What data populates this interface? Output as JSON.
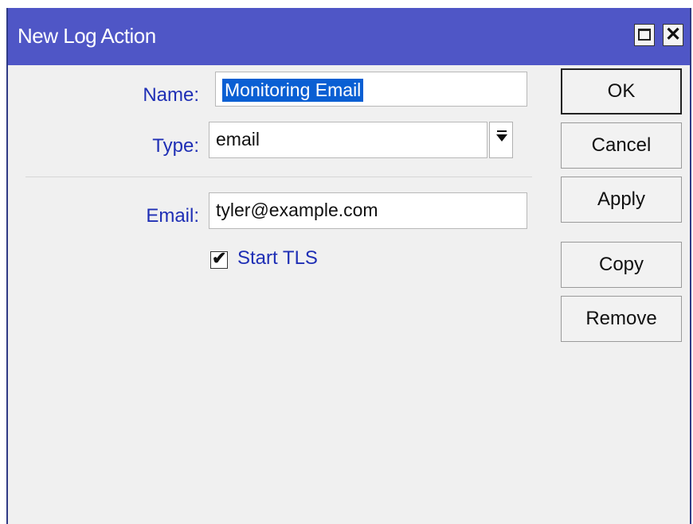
{
  "window": {
    "title": "New Log Action",
    "controls": {
      "maximize_icon": "maximize-icon",
      "close_icon": "close-icon",
      "close_glyph": "✕"
    }
  },
  "form": {
    "name": {
      "label": "Name:",
      "value": "Monitoring Email",
      "selected": true
    },
    "type": {
      "label": "Type:",
      "value": "email",
      "dropdown_icon": "chevron-down-icon"
    },
    "email": {
      "label": "Email:",
      "value": "tyler@example.com"
    },
    "start_tls": {
      "label": "Start TLS",
      "checked": true,
      "mark": "✔"
    }
  },
  "buttons": {
    "ok": "OK",
    "cancel": "Cancel",
    "apply": "Apply",
    "copy": "Copy",
    "remove": "Remove"
  },
  "colors": {
    "titlebar": "#4f56c6",
    "label_text": "#1f2fb5",
    "selection": "#0a5fd3"
  }
}
